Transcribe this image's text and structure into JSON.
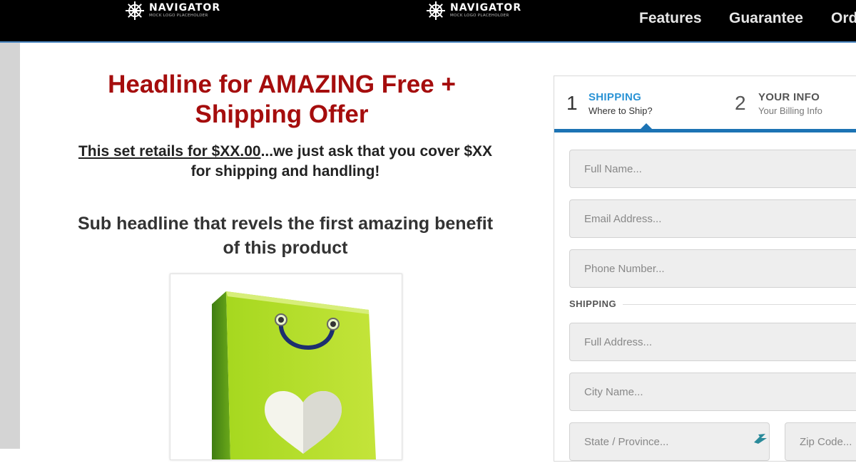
{
  "header": {
    "logo_left": {
      "brand": "NAVIGATOR",
      "sub": "MOCK LOGO PLACEHOLDER"
    },
    "logo_center": {
      "brand": "NAVIGATOR",
      "sub": "MOCK LOGO PLACEHOLDER"
    },
    "nav": [
      {
        "label": "Features"
      },
      {
        "label": "Guarantee"
      },
      {
        "label": "Ord"
      }
    ]
  },
  "main": {
    "headline_line1": "Headline for AMAZING Free +",
    "headline_line2": "Shipping Offer",
    "retail_underlined": "This set retails for $XX.00",
    "retail_rest": "...we just ask that you cover $XX",
    "retail_line2": "for shipping and handling!",
    "subheadline_line1": "Sub headline that revels the first amazing benefit",
    "subheadline_line2": "of this product",
    "product_image_icon": "green-shopping-bag-with-heart"
  },
  "form": {
    "steps": [
      {
        "number": "1",
        "title": "SHIPPING",
        "subtitle": "Where to Ship?"
      },
      {
        "number": "2",
        "title": "YOUR INFO",
        "subtitle": "Your Billing Info"
      }
    ],
    "active_step_color": "#1c73b4",
    "fields": {
      "full_name": "Full Name...",
      "email": "Email Address...",
      "phone": "Phone Number..."
    },
    "shipping_label": "SHIPPING",
    "shipping_fields": {
      "full_address": "Full Address...",
      "city": "City Name...",
      "state": "State / Province...",
      "zip": "Zip Code..."
    }
  },
  "colors": {
    "headline": "#a50d0d",
    "topbar": "#000000",
    "accent": "#1c73b4"
  }
}
